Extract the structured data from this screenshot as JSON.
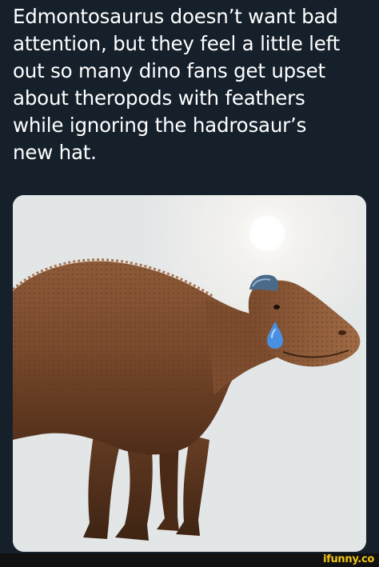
{
  "post": {
    "caption_lines": [
      "Edmontosaurus doesn’t want bad",
      "attention, but they feel a little left",
      "out so many dino fans get upset",
      "about theropods with feathers",
      "while ignoring the hadrosaur’s",
      "new hat."
    ]
  },
  "image": {
    "subject_icon": "edmontosaurus-illustration",
    "tear_icon": "teardrop-emoji",
    "tear_color": "#4a90e2",
    "background_color": "#e6e8e8"
  },
  "footer": {
    "watermark": "ifunny.co",
    "watermark_color": "#f2c515"
  },
  "theme": {
    "background": "#15202b",
    "text": "#ffffff"
  }
}
